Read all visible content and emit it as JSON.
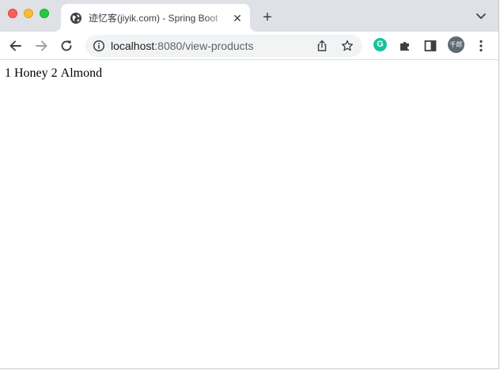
{
  "browser": {
    "tab": {
      "title": "迹忆客(jiyik.com) - Spring Boot",
      "favicon": "globe-icon",
      "close": "✕"
    },
    "new_tab": "+",
    "address": {
      "host": "localhost",
      "path": ":8080/view-products"
    },
    "toolbar_icons": [
      "back-icon",
      "forward-icon",
      "reload-icon",
      "info-icon",
      "share-icon",
      "star-icon",
      "grammarly-extension-icon",
      "extensions-puzzle-icon",
      "side-panel-icon",
      "more-menu-icon"
    ],
    "extension_g_letter": "G",
    "profile_avatar_text": "千郎"
  },
  "page": {
    "products": [
      {
        "id": "1",
        "name": "Honey"
      },
      {
        "id": "2",
        "name": "Almond"
      }
    ]
  },
  "colors": {
    "tabstrip": "#dee1e6",
    "omnibox": "#f1f3f4",
    "grammarly": "#15c39a"
  }
}
